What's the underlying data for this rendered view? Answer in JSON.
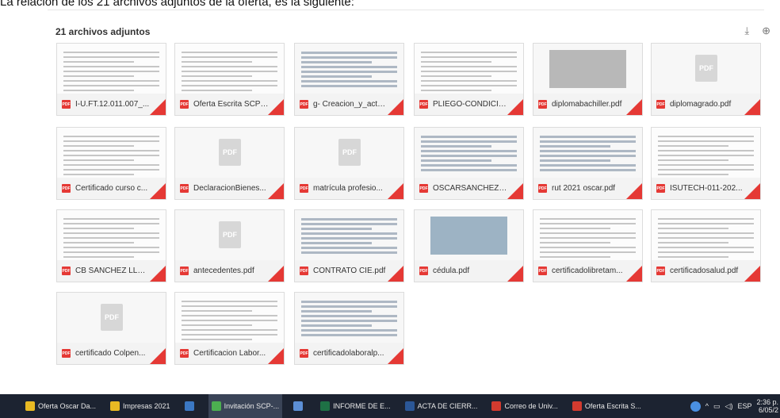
{
  "intro_text": "La relación de los 21 archivos adjuntos de la oferta, es la siguiente:",
  "attachments": {
    "title": "21 archivos adjuntos",
    "download_icon": "download-icon",
    "drive_icon": "add-to-drive-icon",
    "files": [
      {
        "name": "I-U.FT.12.011.007_...",
        "thumb": "doc"
      },
      {
        "name": "Oferta Escrita SCP-...",
        "thumb": "doc"
      },
      {
        "name": "g- Creacion_y_actu...",
        "thumb": "form"
      },
      {
        "name": "PLIEGO-CONDICIO...",
        "thumb": "doc"
      },
      {
        "name": "diplomabachiller.pdf",
        "thumb": "photo"
      },
      {
        "name": "diplomagrado.pdf",
        "thumb": "pdf"
      },
      {
        "name": "Certificado curso c...",
        "thumb": "doc"
      },
      {
        "name": "DeclaracionBienes...",
        "thumb": "pdf"
      },
      {
        "name": "matrícula profesio...",
        "thumb": "pdf"
      },
      {
        "name": "OSCARSANCHEZO...",
        "thumb": "form"
      },
      {
        "name": "rut 2021 oscar.pdf",
        "thumb": "form"
      },
      {
        "name": "ISUTECH-011-202...",
        "thumb": "doc"
      },
      {
        "name": "CB SANCHEZ LLOR...",
        "thumb": "doc"
      },
      {
        "name": "antecedentes.pdf",
        "thumb": "pdf"
      },
      {
        "name": "CONTRATO CIE.pdf",
        "thumb": "form"
      },
      {
        "name": "cédula.pdf",
        "thumb": "photo"
      },
      {
        "name": "certificadolibretam...",
        "thumb": "doc"
      },
      {
        "name": "certificadosalud.pdf",
        "thumb": "doc"
      },
      {
        "name": "certificado Colpen...",
        "thumb": "pdf"
      },
      {
        "name": "Certificacion Labor...",
        "thumb": "doc"
      },
      {
        "name": "certificadolaboralp...",
        "thumb": "form"
      }
    ],
    "thumb_texts": {
      "pdf_placeholder": "PDF",
      "cert_title": "Certificado",
      "cert_sub": "Bancario",
      "vida": "HOJA DE VIDA",
      "rut_code": "001"
    }
  },
  "taskbar": {
    "items": [
      {
        "label": "Oferta Oscar Da...",
        "color": "#e8b923",
        "active": false
      },
      {
        "label": "Impresas 2021",
        "color": "#e8b923",
        "active": false
      },
      {
        "label": "",
        "color": "#3b78c4",
        "active": false
      },
      {
        "label": "Invitación SCP-...",
        "color": "#4caf50",
        "active": true
      },
      {
        "label": "",
        "color": "#5c8fd6",
        "active": false
      },
      {
        "label": "INFORME DE E...",
        "color": "#1e7145",
        "active": false
      },
      {
        "label": "ACTA DE CIERR...",
        "color": "#2b5797",
        "active": false
      },
      {
        "label": "Correo de Univ...",
        "color": "#d23b2f",
        "active": false
      },
      {
        "label": "Oferta Escrita S...",
        "color": "#d23b2f",
        "active": false
      }
    ],
    "tray": {
      "help_icon": "help-icon",
      "chevron": "^",
      "lang": "ESP",
      "time": "2:36 p.",
      "date": "6/05/2"
    }
  }
}
